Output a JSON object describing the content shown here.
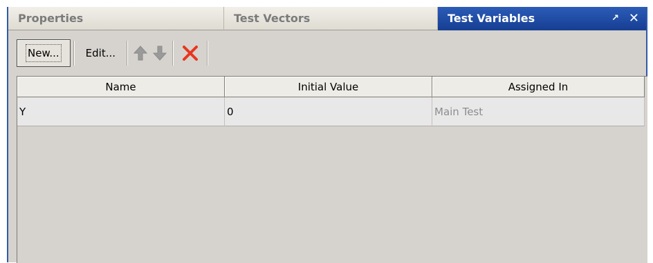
{
  "tabs": [
    {
      "label": "Properties",
      "active": false
    },
    {
      "label": "Test Vectors",
      "active": false
    },
    {
      "label": "Test Variables",
      "active": true
    }
  ],
  "tab_controls": {
    "pin": "↗",
    "close": "✕"
  },
  "toolbar": {
    "new_label": "New...",
    "edit_label": "Edit...",
    "icons": [
      "move-up-icon",
      "move-down-icon",
      "delete-icon"
    ]
  },
  "table": {
    "columns": [
      "Name",
      "Initial Value",
      "Assigned In"
    ],
    "rows": [
      [
        "Y",
        "0",
        "Main Test"
      ]
    ]
  },
  "colors": {
    "active_tab": "#1f4fa8",
    "delete_icon": "#e8361e",
    "panel_bg": "#d6d3ce"
  }
}
